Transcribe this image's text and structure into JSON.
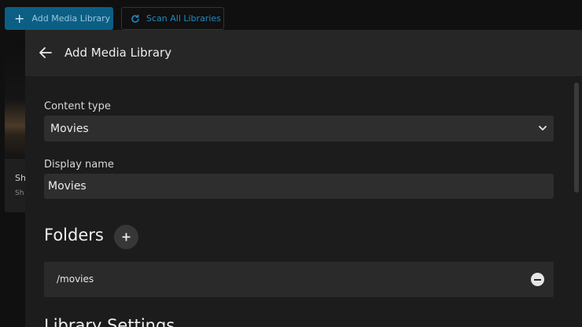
{
  "toolbar": {
    "add_library_label": "Add Media Library",
    "scan_all_label": "Scan All Libraries"
  },
  "background_card": {
    "title_fragment": "Sh",
    "subtitle_fragment": "Sh"
  },
  "dialog": {
    "title": "Add Media Library",
    "content_type": {
      "label": "Content type",
      "selected": "Movies"
    },
    "display_name": {
      "label": "Display name",
      "value": "Movies"
    },
    "folders": {
      "title": "Folders",
      "items": [
        {
          "path": "/movies"
        }
      ]
    },
    "library_settings_title": "Library Settings"
  },
  "colors": {
    "accent": "#0b5f85",
    "accent_text": "#1e8bc3",
    "dialog_bg": "#1c1c1c",
    "field_bg": "#2e2e2e"
  },
  "icons": {
    "add": "plus-icon",
    "scan": "refresh-icon",
    "back": "arrow-left-icon",
    "dropdown": "chevron-down-icon",
    "add_folder": "plus-icon",
    "remove_folder": "minus-circle-icon"
  }
}
